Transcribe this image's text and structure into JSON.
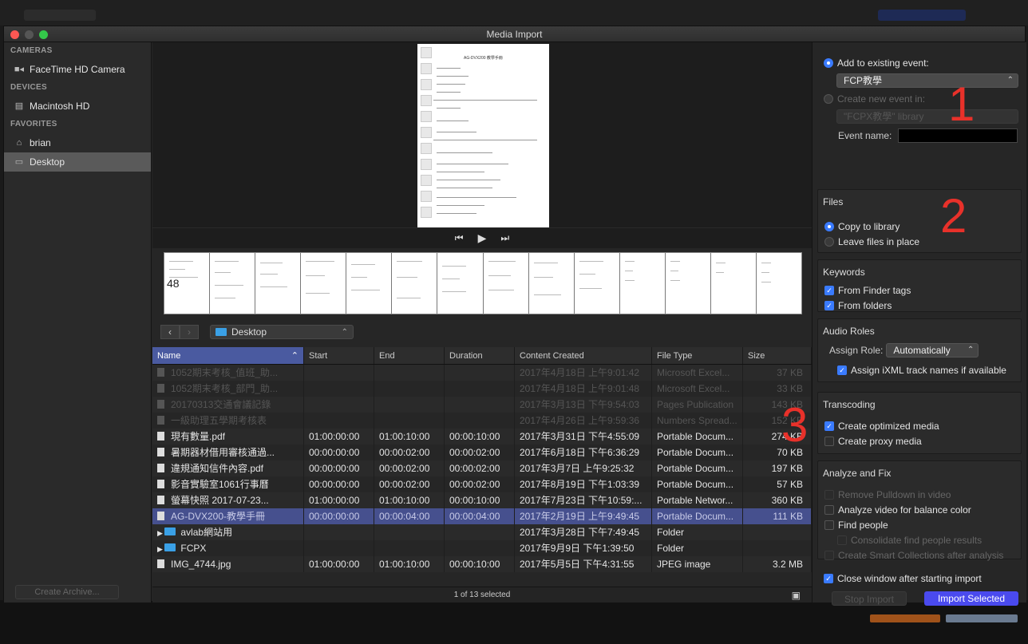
{
  "window": {
    "title": "Media Import"
  },
  "sidebar": {
    "sections": [
      {
        "heading": "CAMERAS",
        "items": [
          {
            "label": "FaceTime HD Camera",
            "icon": "camera-icon"
          }
        ]
      },
      {
        "heading": "DEVICES",
        "items": [
          {
            "label": "Macintosh HD",
            "icon": "disk-icon"
          }
        ]
      },
      {
        "heading": "FAVORITES",
        "items": [
          {
            "label": "brian",
            "icon": "home-icon"
          },
          {
            "label": "Desktop",
            "icon": "desktop-icon",
            "selected": true
          }
        ]
      }
    ],
    "archive_button": "Create Archive..."
  },
  "viewer": {
    "doc_heading": "AG-DVX200 教學手冊"
  },
  "browser": {
    "location": "Desktop",
    "columns": {
      "name": "Name",
      "start": "Start",
      "end": "End",
      "duration": "Duration",
      "content_created": "Content Created",
      "file_type": "File Type",
      "size": "Size"
    },
    "rows": [
      {
        "name": "1052期末考核_值班_助...",
        "start": "",
        "end": "",
        "duration": "",
        "created": "2017年4月18日 上午9:01:42",
        "type": "Microsoft Excel...",
        "size": "37 KB",
        "dim": true
      },
      {
        "name": "1052期末考核_部門_助...",
        "start": "",
        "end": "",
        "duration": "",
        "created": "2017年4月18日 上午9:01:48",
        "type": "Microsoft Excel...",
        "size": "33 KB",
        "dim": true
      },
      {
        "name": "20170313交通會議記錄",
        "start": "",
        "end": "",
        "duration": "",
        "created": "2017年3月13日 下午9:54:03",
        "type": "Pages Publication",
        "size": "143 KB",
        "dim": true
      },
      {
        "name": "一級助理五學期考核表",
        "start": "",
        "end": "",
        "duration": "",
        "created": "2017年4月26日 上午9:59:36",
        "type": "Numbers Spread...",
        "size": "152 KB",
        "dim": true
      },
      {
        "name": "現有數量.pdf",
        "start": "01:00:00:00",
        "end": "01:00:10:00",
        "duration": "00:00:10:00",
        "created": "2017年3月31日 下午4:55:09",
        "type": "Portable Docum...",
        "size": "274 KB"
      },
      {
        "name": "暑期器材借用審核通過...",
        "start": "00:00:00:00",
        "end": "00:00:02:00",
        "duration": "00:00:02:00",
        "created": "2017年6月18日 下午6:36:29",
        "type": "Portable Docum...",
        "size": "70 KB"
      },
      {
        "name": "違規通知信件內容.pdf",
        "start": "00:00:00:00",
        "end": "00:00:02:00",
        "duration": "00:00:02:00",
        "created": "2017年3月7日 上午9:25:32",
        "type": "Portable Docum...",
        "size": "197 KB"
      },
      {
        "name": "影音實驗室1061行事曆",
        "start": "00:00:00:00",
        "end": "00:00:02:00",
        "duration": "00:00:02:00",
        "created": "2017年8月19日 下午1:03:39",
        "type": "Portable Docum...",
        "size": "57 KB"
      },
      {
        "name": "螢幕快照 2017-07-23...",
        "start": "01:00:00:00",
        "end": "01:00:10:00",
        "duration": "00:00:10:00",
        "created": "2017年7月23日 下午10:59:...",
        "type": "Portable Networ...",
        "size": "360 KB"
      },
      {
        "name": "AG-DVX200-教學手冊",
        "start": "00:00:00:00",
        "end": "00:00:04:00",
        "duration": "00:00:04:00",
        "created": "2017年2月19日 上午9:49:45",
        "type": "Portable Docum...",
        "size": "111 KB",
        "selected": true
      },
      {
        "name": "avlab網站用",
        "start": "",
        "end": "",
        "duration": "",
        "created": "2017年3月28日 下午7:49:45",
        "type": "Folder",
        "size": "",
        "folder": true
      },
      {
        "name": "FCPX",
        "start": "",
        "end": "",
        "duration": "",
        "created": "2017年9月9日 下午1:39:50",
        "type": "Folder",
        "size": "",
        "folder": true
      },
      {
        "name": "IMG_4744.jpg",
        "start": "01:00:00:00",
        "end": "01:00:10:00",
        "duration": "00:00:10:00",
        "created": "2017年5月5日 下午4:31:55",
        "type": "JPEG image",
        "size": "3.2 MB"
      }
    ],
    "status": "1 of 13 selected"
  },
  "options": {
    "add_existing_label": "Add to existing event:",
    "event_value": "FCP教學",
    "create_new_label": "Create new event in:",
    "library_value": "\"FCPX教學\" library",
    "event_name_label": "Event name:",
    "files": {
      "title": "Files",
      "copy": "Copy to library",
      "leave": "Leave files in place"
    },
    "keywords": {
      "title": "Keywords",
      "finder": "From Finder tags",
      "folders": "From folders"
    },
    "audio": {
      "title": "Audio Roles",
      "assign_label": "Assign Role:",
      "assign_value": "Automatically",
      "ixml": "Assign iXML track names if available"
    },
    "transcoding": {
      "title": "Transcoding",
      "optimized": "Create optimized media",
      "proxy": "Create proxy media"
    },
    "analyze": {
      "title": "Analyze and Fix",
      "pulldown": "Remove Pulldown in video",
      "balance": "Analyze video for balance color",
      "people": "Find people",
      "consolidate": "Consolidate find people results",
      "smart": "Create Smart Collections after analysis"
    },
    "close_after": "Close window after starting import",
    "stop_button": "Stop Import",
    "import_button": "Import Selected"
  },
  "annotations": {
    "one": "1",
    "two": "2",
    "three": "3"
  },
  "colors": {
    "accent": "#3a7bff",
    "annotation": "#e8312a",
    "selection": "#46508e"
  }
}
